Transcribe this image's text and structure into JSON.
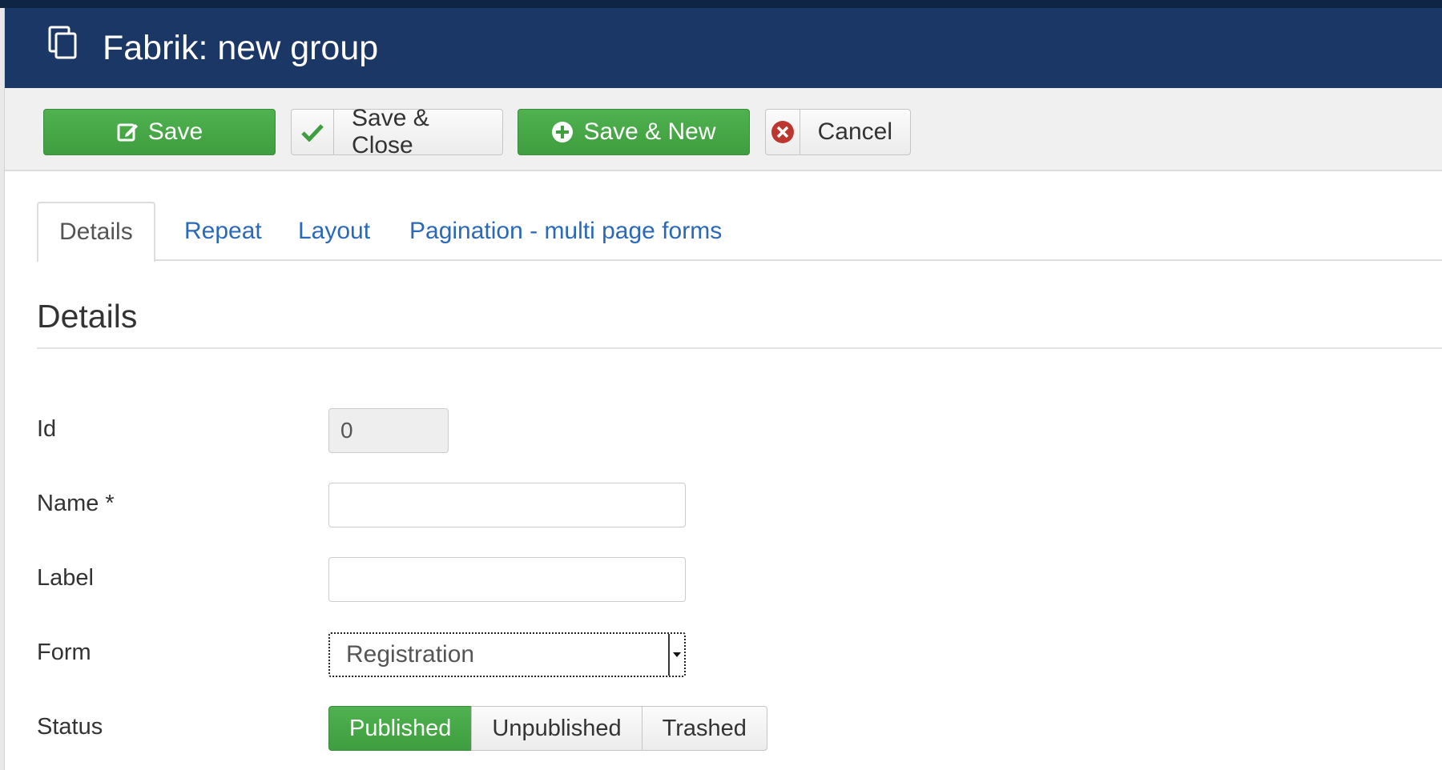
{
  "header": {
    "title": "Fabrik: new group",
    "icon": "copy-icon"
  },
  "toolbar": {
    "save_label": "Save",
    "save_close_label": "Save & Close",
    "save_new_label": "Save & New",
    "cancel_label": "Cancel"
  },
  "tabs": [
    {
      "label": "Details",
      "active": true
    },
    {
      "label": "Repeat",
      "active": false
    },
    {
      "label": "Layout",
      "active": false
    },
    {
      "label": "Pagination - multi page forms",
      "active": false
    }
  ],
  "section": {
    "title": "Details"
  },
  "fields": {
    "id": {
      "label": "Id",
      "value": "0"
    },
    "name": {
      "label": "Name *",
      "value": ""
    },
    "label": {
      "label": "Label",
      "value": ""
    },
    "form": {
      "label": "Form",
      "value": "Registration"
    },
    "status": {
      "label": "Status",
      "options": [
        "Published",
        "Unpublished",
        "Trashed"
      ],
      "selected": "Published"
    }
  },
  "colors": {
    "header_bg": "#1b3766",
    "success": "#46a546",
    "link": "#2a69b8",
    "cancel_icon": "#bd362f"
  }
}
